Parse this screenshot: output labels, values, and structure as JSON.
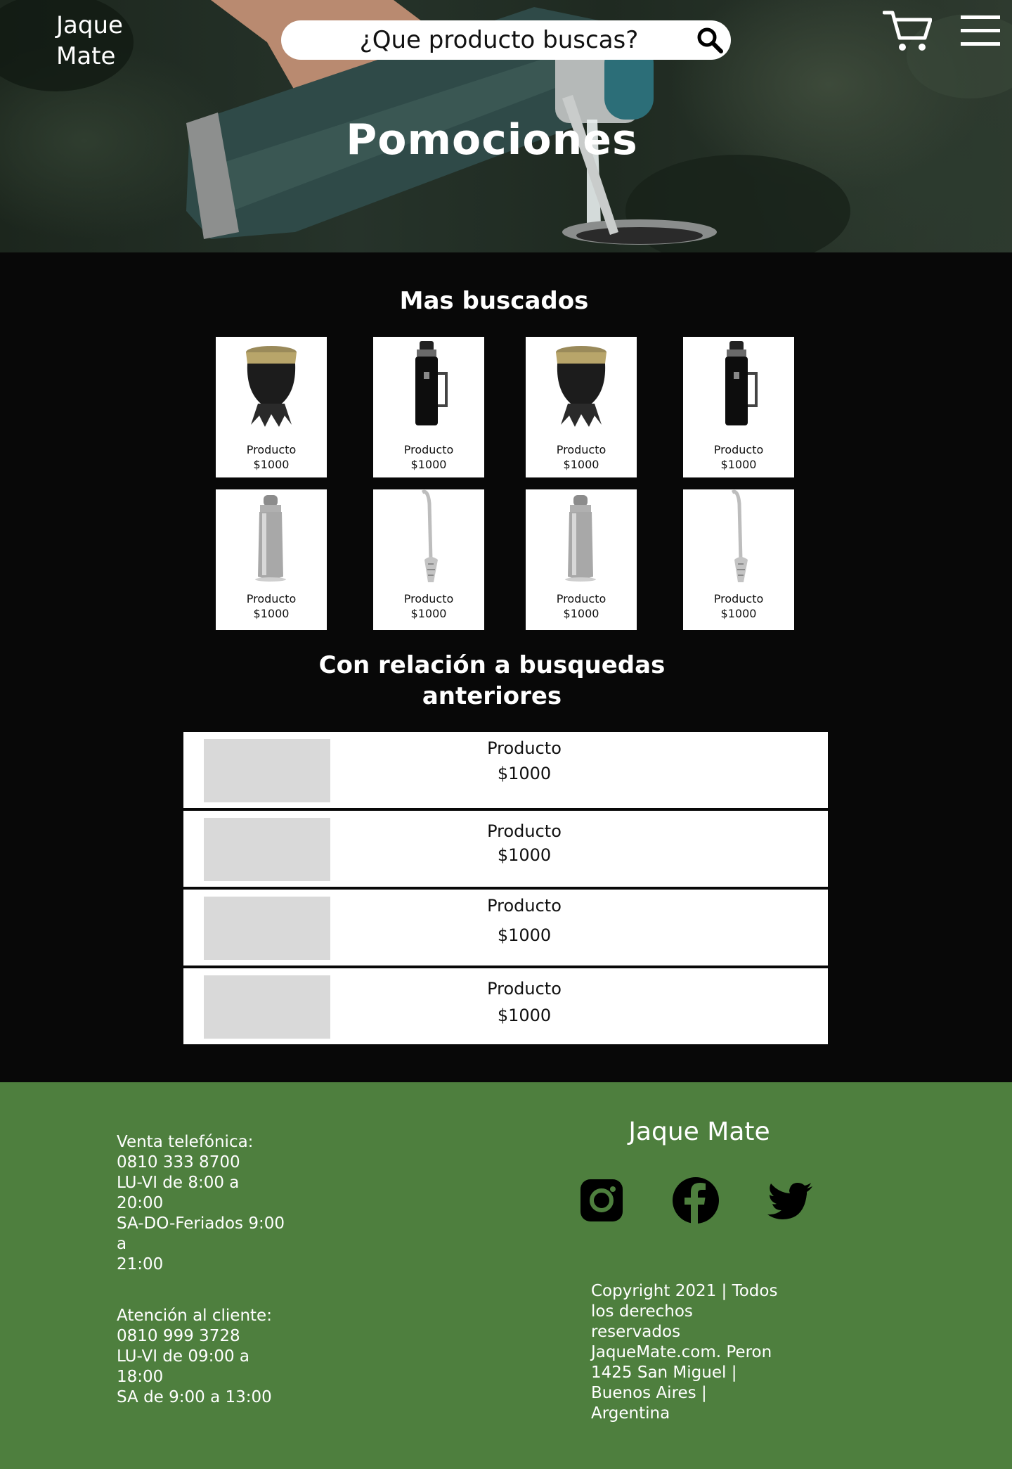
{
  "header": {
    "logo_line1": "Jaque",
    "logo_line2": "Mate",
    "search_placeholder": "¿Que producto buscas?",
    "hero_title": "Pomociones"
  },
  "most_searched": {
    "title": "Mas buscados",
    "products": [
      {
        "name": "Producto",
        "price": "$1000",
        "icon": "mate-cup-icon"
      },
      {
        "name": "Producto",
        "price": "$1000",
        "icon": "thermos-icon"
      },
      {
        "name": "Producto",
        "price": "$1000",
        "icon": "mate-cup-icon"
      },
      {
        "name": "Producto",
        "price": "$1000",
        "icon": "thermos-icon"
      },
      {
        "name": "Producto",
        "price": "$1000",
        "icon": "steel-thermos-icon"
      },
      {
        "name": "Producto",
        "price": "$1000",
        "icon": "bombilla-icon"
      },
      {
        "name": "Producto",
        "price": "$1000",
        "icon": "steel-thermos-icon"
      },
      {
        "name": "Producto",
        "price": "$1000",
        "icon": "bombilla-icon"
      }
    ]
  },
  "related": {
    "title_line1": "Con relación a busquedas",
    "title_line2": "anteriores",
    "items": [
      {
        "name": "Producto",
        "price": "$1000"
      },
      {
        "name": "Producto",
        "price": "$1000"
      },
      {
        "name": "Producto",
        "price": "$1000"
      },
      {
        "name": "Producto",
        "price": "$1000"
      }
    ]
  },
  "footer": {
    "sales_phone": [
      "Venta telefónica:",
      "0810 333 8700",
      "LU-VI de 8:00 a",
      "20:00",
      "SA-DO-Feriados 9:00",
      "a",
      "21:00"
    ],
    "customer_service": [
      "Atención al cliente:",
      "0810 999 3728",
      "LU-VI de 09:00 a",
      "18:00",
      "SA de 9:00 a 13:00"
    ],
    "brand": "Jaque Mate",
    "social": [
      "instagram-icon",
      "facebook-icon",
      "twitter-icon"
    ],
    "copyright": [
      "Copyright 2021 | Todos",
      "los derechos",
      "reservados",
      "JaqueMate.com. Peron",
      "1425 San Miguel |",
      "Buenos Aires |",
      "Argentina"
    ]
  },
  "colors": {
    "footer_bg": "#4e7f3e",
    "page_bg": "#080808",
    "placeholder_gray": "#d9d9d9"
  }
}
